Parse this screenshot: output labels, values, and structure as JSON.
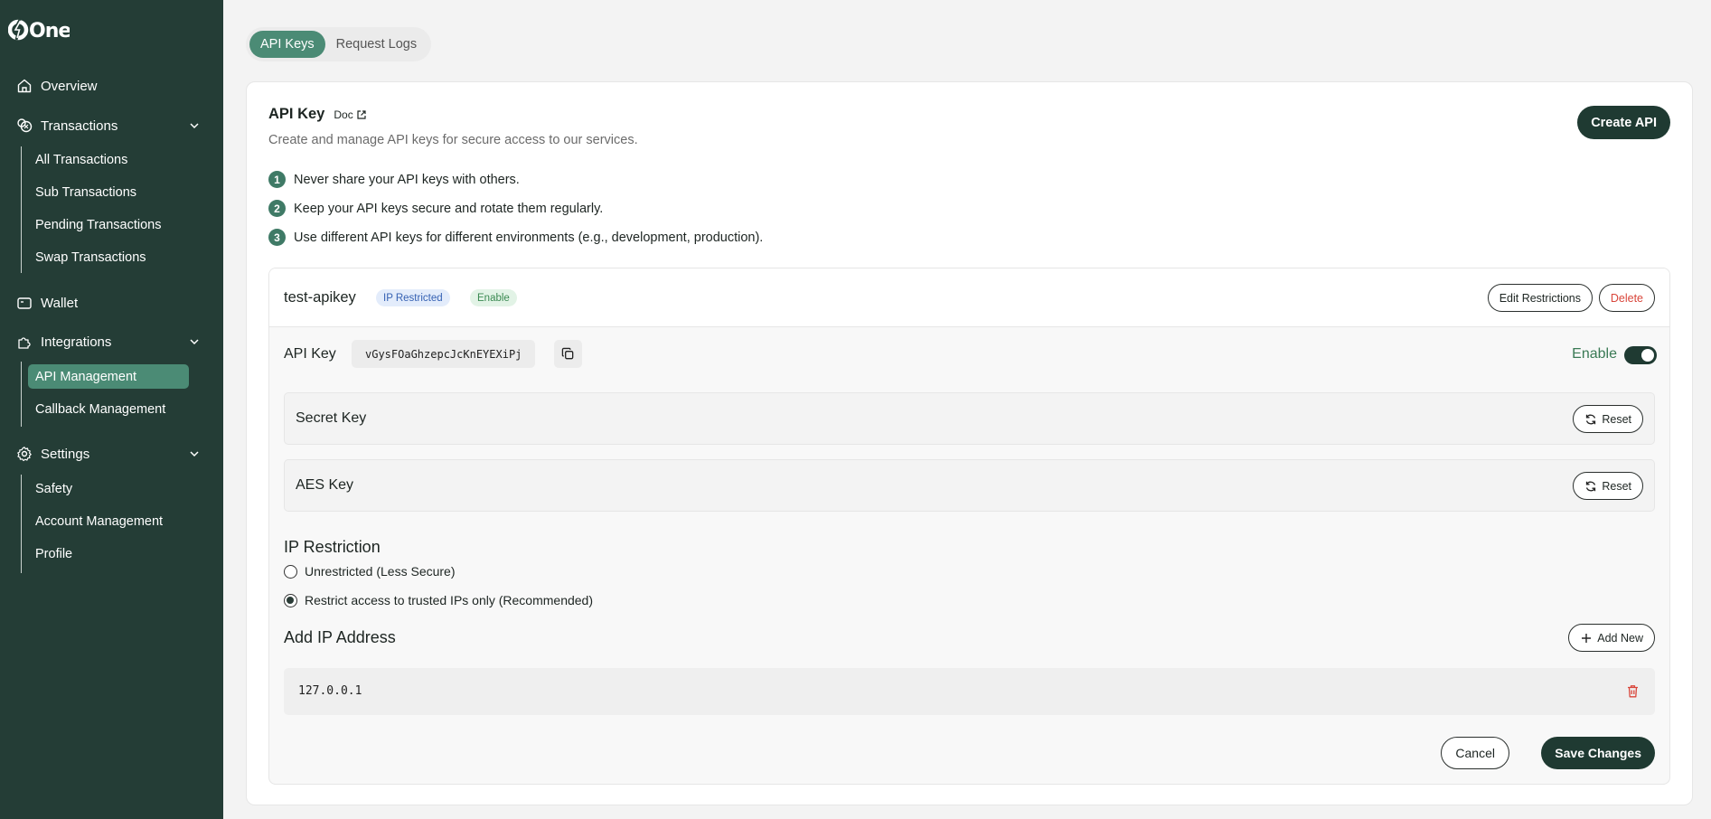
{
  "brand": {
    "logo_text": "One"
  },
  "sidebar": {
    "overview": "Overview",
    "transactions": {
      "label": "Transactions",
      "items": [
        "All Transactions",
        "Sub Transactions",
        "Pending Transactions",
        "Swap Transactions"
      ]
    },
    "wallet": "Wallet",
    "integrations": {
      "label": "Integrations",
      "items": [
        "API Management",
        "Callback Management"
      ],
      "active": "API Management"
    },
    "settings": {
      "label": "Settings",
      "items": [
        "Safety",
        "Account Management",
        "Profile"
      ]
    }
  },
  "tabs": [
    {
      "label": "API Keys",
      "active": true
    },
    {
      "label": "Request Logs",
      "active": false
    }
  ],
  "card": {
    "title": "API Key",
    "doc_link": "Doc",
    "subtitle": "Create and manage API keys for secure access to our services.",
    "create_button": "Create API",
    "tips": [
      {
        "num": "1",
        "text": "Never share your API keys with others."
      },
      {
        "num": "2",
        "text": "Keep your API keys secure and rotate them regularly."
      },
      {
        "num": "3",
        "text": "Use different API keys for different environments (e.g., development, production)."
      }
    ]
  },
  "key": {
    "name": "test-apikey",
    "badge_ip": "IP Restricted",
    "badge_status": "Enable",
    "edit_button": "Edit Restrictions",
    "delete_button": "Delete",
    "api_key_label": "API Key",
    "api_key_value": "vGysFOaGhzepcJcKnEYEXiPj",
    "enable_label": "Enable",
    "enabled": true,
    "secret_key_label": "Secret Key",
    "aes_key_label": "AES Key",
    "reset_button": "Reset",
    "ip_restriction_title": "IP Restriction",
    "radio_options": [
      {
        "label": "Unrestricted (Less Secure)",
        "selected": false
      },
      {
        "label": "Restrict access to trusted IPs only (Recommended)",
        "selected": true
      }
    ],
    "add_ip_title": "Add IP Address",
    "add_new_button": "Add New",
    "ip_addresses": [
      "127.0.0.1"
    ],
    "cancel_button": "Cancel",
    "save_button": "Save Changes"
  },
  "colors": {
    "sidebar_bg": "#243d36",
    "accent": "#4b8b75",
    "primary_button": "#1f3a32",
    "danger": "#d9463b"
  },
  "icons": {
    "overview": "home-icon",
    "transactions": "coins-icon",
    "wallet": "wallet-icon",
    "integrations": "puzzle-icon",
    "settings": "gear-icon"
  }
}
